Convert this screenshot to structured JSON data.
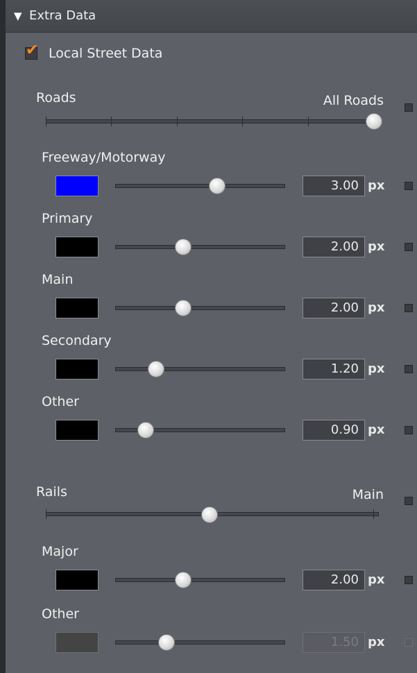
{
  "section": {
    "title": "Extra Data"
  },
  "local_street": {
    "label": "Local Street Data",
    "checked": true
  },
  "roads": {
    "label": "Roads",
    "value_label": "All Roads",
    "tiers": [
      {
        "label": "Freeway/Motorway",
        "color": "#0000ff",
        "value": "3.00",
        "unit": "px",
        "fraction": 0.6
      },
      {
        "label": "Primary",
        "color": "#000000",
        "value": "2.00",
        "unit": "px",
        "fraction": 0.4
      },
      {
        "label": "Main",
        "color": "#000000",
        "value": "2.00",
        "unit": "px",
        "fraction": 0.4
      },
      {
        "label": "Secondary",
        "color": "#000000",
        "value": "1.20",
        "unit": "px",
        "fraction": 0.24
      },
      {
        "label": "Other",
        "color": "#000000",
        "value": "0.90",
        "unit": "px",
        "fraction": 0.18
      }
    ]
  },
  "rails": {
    "label": "Rails",
    "value_label": "Main",
    "tiers": [
      {
        "label": "Major",
        "color": "#000000",
        "value": "2.00",
        "unit": "px",
        "fraction": 0.4
      },
      {
        "label": "Other",
        "color": "#444444",
        "value": "1.50",
        "unit": "px",
        "fraction": 0.3
      }
    ]
  }
}
